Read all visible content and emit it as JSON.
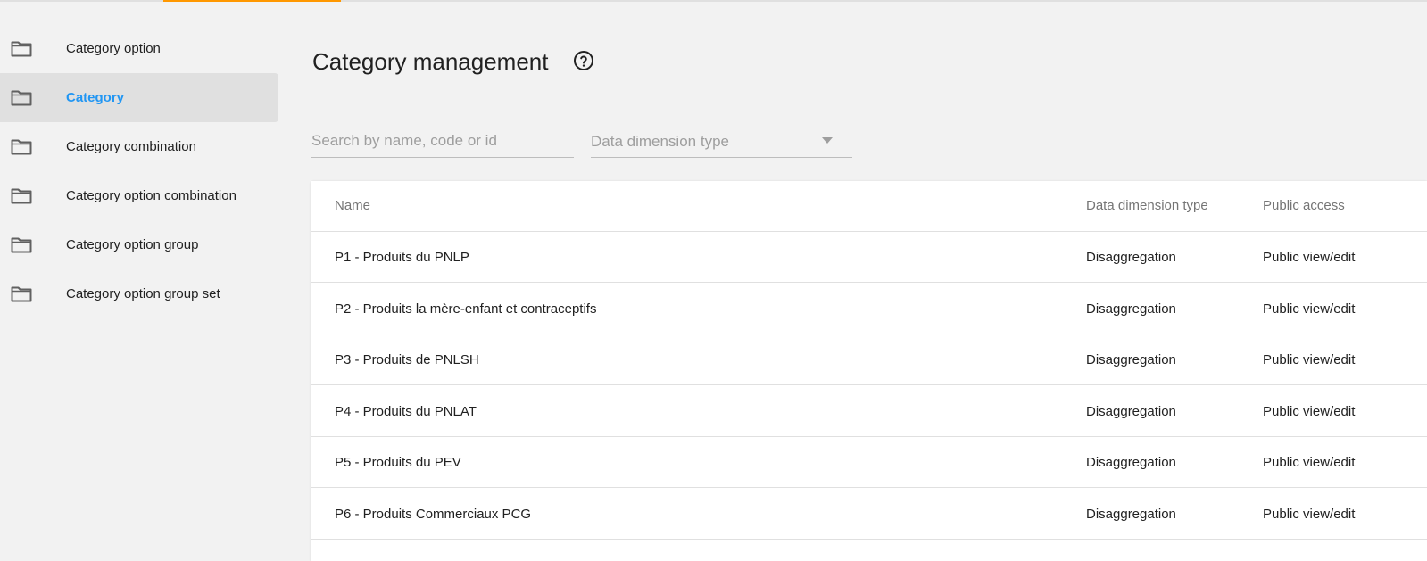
{
  "sidebar": {
    "items": [
      {
        "label": "Category option",
        "icon": "folder-icon"
      },
      {
        "label": "Category",
        "icon": "folder-icon",
        "active": true
      },
      {
        "label": "Category combination",
        "icon": "folder-icon"
      },
      {
        "label": "Category option combination",
        "icon": "folder-icon"
      },
      {
        "label": "Category option group",
        "icon": "folder-icon"
      },
      {
        "label": "Category option group set",
        "icon": "folder-icon"
      }
    ]
  },
  "header": {
    "title": "Category management",
    "help_icon": "help-circle-icon"
  },
  "filters": {
    "search_placeholder": "Search by name, code or id",
    "search_value": "",
    "dimension_type_label": "Data dimension type"
  },
  "table": {
    "columns": [
      "Name",
      "Data dimension type",
      "Public access"
    ],
    "rows": [
      {
        "name": "P1 - Produits du PNLP",
        "type": "Disaggregation",
        "access": "Public view/edit"
      },
      {
        "name": "P2 - Produits la mère-enfant et contraceptifs",
        "type": "Disaggregation",
        "access": "Public view/edit"
      },
      {
        "name": "P3 - Produits de PNLSH",
        "type": "Disaggregation",
        "access": "Public view/edit"
      },
      {
        "name": "P4 - Produits du PNLAT",
        "type": "Disaggregation",
        "access": "Public view/edit"
      },
      {
        "name": "P5 - Produits du PEV",
        "type": "Disaggregation",
        "access": "Public view/edit"
      },
      {
        "name": "P6 - Produits Commerciaux PCG",
        "type": "Disaggregation",
        "access": "Public view/edit"
      }
    ]
  },
  "colors": {
    "accent": "#2196f3",
    "top_tab_indicator": "#ff9800",
    "background": "#f2f2f2"
  }
}
